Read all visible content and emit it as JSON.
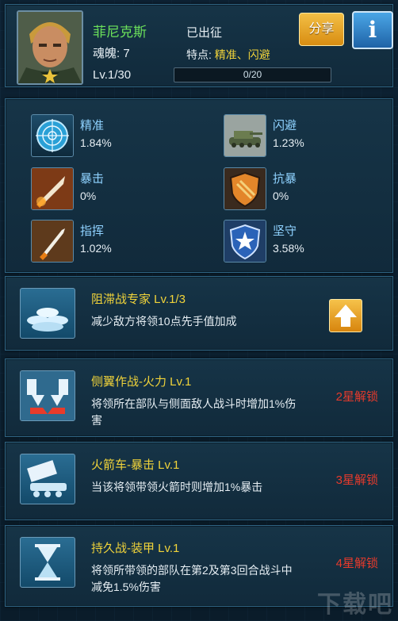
{
  "hero": {
    "name": "菲尼克斯",
    "soul": "魂魄: 7",
    "level": "Lv.1/30",
    "status": "已出征",
    "traits_label": "特点: ",
    "traits_value": "精准、闪避",
    "progress_text": "0/20",
    "progress_value": 0
  },
  "buttons": {
    "share": "分享",
    "info": "i"
  },
  "stats": [
    {
      "name": "精准",
      "value": "1.84%",
      "icon": "radar-target-icon"
    },
    {
      "name": "闪避",
      "value": "1.23%",
      "icon": "tank-icon"
    },
    {
      "name": "暴击",
      "value": "0%",
      "icon": "missile-icon"
    },
    {
      "name": "抗暴",
      "value": "0%",
      "icon": "shield-icon"
    },
    {
      "name": "指挥",
      "value": "1.02%",
      "icon": "rocket-icon"
    },
    {
      "name": "坚守",
      "value": "3.58%",
      "icon": "star-shield-icon"
    }
  ],
  "skills": [
    {
      "title": "阻滞战专家 Lv.1/3",
      "desc": "减少敌方将领10点先手值加成",
      "lock": "",
      "icon": "sandbag-icon"
    },
    {
      "title": "侧翼作战-火力 Lv.1",
      "desc": "将领所在部队与侧面敌人战斗时增加1%伤害",
      "lock": "2星解锁",
      "icon": "flank-arrow-icon"
    },
    {
      "title": "火箭车-暴击 Lv.1",
      "desc": "当该将领带领火箭时则增加1%暴击",
      "lock": "3星解锁",
      "icon": "rocket-launcher-icon"
    },
    {
      "title": "持久战-装甲 Lv.1",
      "desc": "将领所带领的部队在第2及第3回合战斗中减免1.5%伤害",
      "lock": "4星解锁",
      "icon": "hourglass-icon"
    }
  ],
  "colors": {
    "name": "#6be05a",
    "skill_title": "#f0d33a",
    "lock": "#e63a2c",
    "stat_name": "#8fd2ff"
  },
  "watermark": "下载吧"
}
